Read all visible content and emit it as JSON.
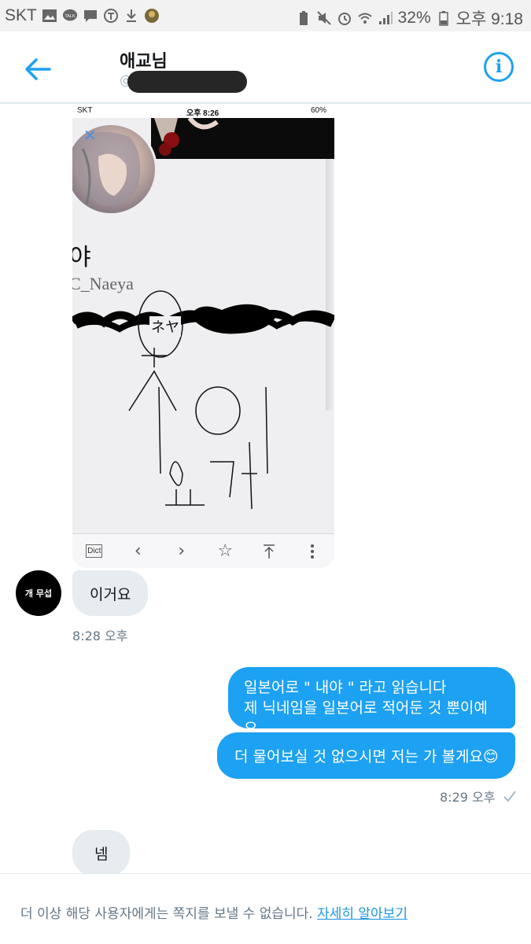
{
  "status_bar": {
    "carrier": "SKT",
    "battery": "32%",
    "time": "오후 9:18"
  },
  "header": {
    "title": "애교님",
    "handle_prefix": "@"
  },
  "shared_image": {
    "status_carrier": "SKT",
    "status_time": "오후 8:26",
    "status_battery": "60%",
    "profile_name": "야",
    "profile_handle": "C_Naeya",
    "scribble_katakana": "ネヤ",
    "toolbar_dict": "Dict"
  },
  "partner_avatar_label": "개 무섭",
  "messages": [
    {
      "from": "them",
      "text": "이거요",
      "time": "8:28 오후"
    },
    {
      "from": "me",
      "lines": [
        "일본어로 \" 내야 \" 라고 읽습니다",
        "제 닉네임을 일본어로 적어둔 것 뿐이예요"
      ]
    },
    {
      "from": "me",
      "text": "더 물어보실 것 없으시면 저는 가 볼게요😊",
      "time": "8:29 오후"
    },
    {
      "from": "them",
      "text": "넴"
    }
  ],
  "footer": {
    "notice": "더 이상 해당 사용자에게는 쪽지를 보낼 수 없습니다.",
    "link": "자세히 알아보기"
  },
  "colors": {
    "accent": "#1da1f2",
    "incoming_bubble": "#e6ecf0"
  }
}
